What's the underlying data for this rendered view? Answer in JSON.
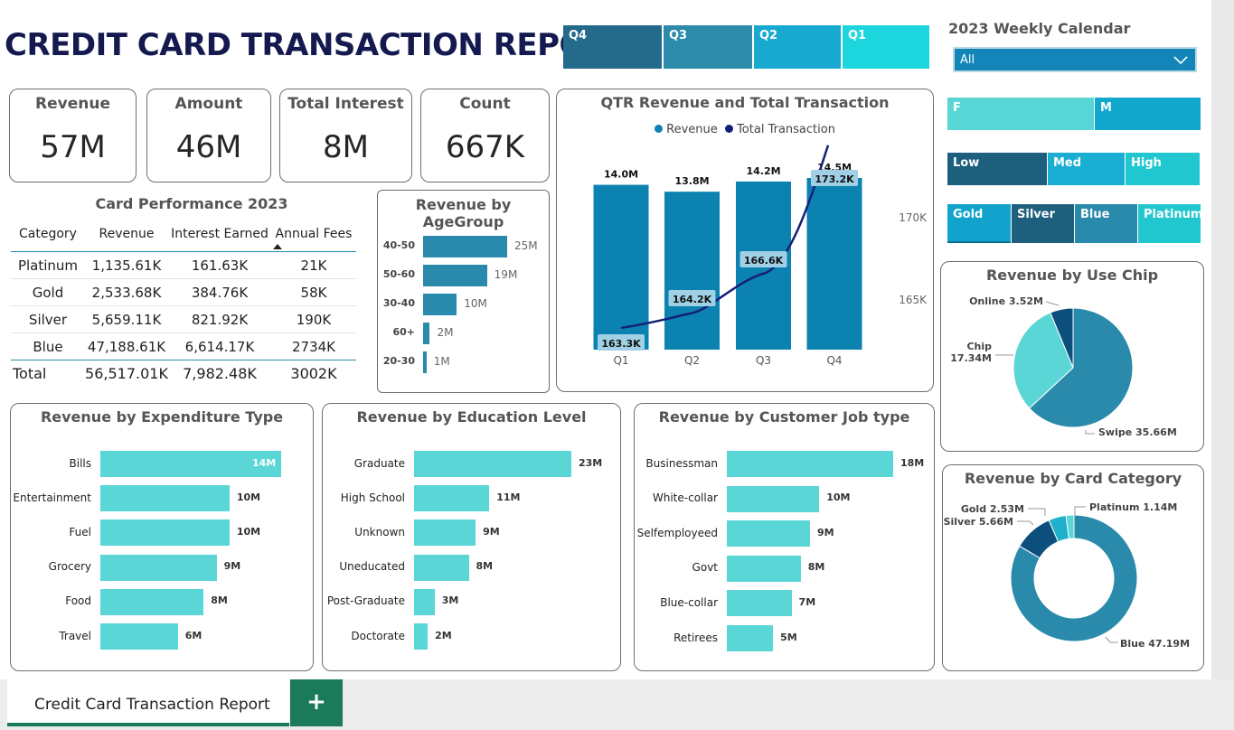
{
  "report_title": "CREDIT CARD TRANSACTION REPORT",
  "colors": {
    "teal_light": "#5ad6d6",
    "teal_mid": "#0c82b0",
    "navy": "#142078",
    "dark_slate": "#1f5f7e"
  },
  "quarter_slicer": {
    "items": [
      "Q4",
      "Q3",
      "Q2",
      "Q1"
    ]
  },
  "calendar": {
    "title": "2023 Weekly Calendar",
    "selected": "All"
  },
  "gender_slicer": {
    "items": [
      "F",
      "M"
    ]
  },
  "income_slicer": {
    "items": [
      "Low",
      "Med",
      "High"
    ]
  },
  "category_slicer": {
    "items": [
      "Gold",
      "Silver",
      "Blue",
      "Platinum"
    ]
  },
  "kpis": [
    {
      "label": "Revenue",
      "value": "57M"
    },
    {
      "label": "Amount",
      "value": "46M"
    },
    {
      "label": "Total Interest",
      "value": "8M"
    },
    {
      "label": "Count",
      "value": "667K"
    }
  ],
  "card_performance": {
    "title": "Card Performance 2023",
    "headers": [
      "Category",
      "Revenue",
      "Interest Earned",
      "Annual Fees"
    ],
    "rows": [
      [
        "Platinum",
        "1,135.61K",
        "161.63K",
        "21K"
      ],
      [
        "Gold",
        "2,533.68K",
        "384.76K",
        "58K"
      ],
      [
        "Silver",
        "5,659.11K",
        "821.92K",
        "190K"
      ],
      [
        "Blue",
        "47,188.61K",
        "6,614.17K",
        "2734K"
      ]
    ],
    "total": [
      "Total",
      "56,517.01K",
      "7,982.48K",
      "3002K"
    ]
  },
  "chart_data": [
    {
      "id": "age",
      "type": "bar",
      "title": "Revenue by AgeGroup",
      "categories": [
        "40-50",
        "50-60",
        "30-40",
        "60+",
        "20-30"
      ],
      "values": [
        25,
        19,
        10,
        2,
        1
      ],
      "labels": [
        "25M",
        "19M",
        "10M",
        "2M",
        "1M"
      ],
      "color": "#2a8aab"
    },
    {
      "id": "qtr",
      "type": "bar",
      "title": "QTR Revenue and Total Transaction",
      "legend": [
        "Revenue",
        "Total Transaction"
      ],
      "categories": [
        "Q1",
        "Q2",
        "Q3",
        "Q4"
      ],
      "series": [
        {
          "name": "Revenue",
          "values": [
            14.0,
            13.8,
            14.2,
            14.5
          ],
          "labels": [
            "14.0M",
            "13.8M",
            "14.2M",
            "14.5M"
          ]
        },
        {
          "name": "Total Transaction",
          "values": [
            163.3,
            164.2,
            166.6,
            173.2
          ],
          "labels": [
            "163.3K",
            "164.2K",
            "166.6K",
            "173.2K"
          ]
        }
      ],
      "y2_ticks": [
        "170K",
        "165K"
      ]
    },
    {
      "id": "exp",
      "type": "bar",
      "title": "Revenue by Expenditure Type",
      "categories": [
        "Bills",
        "Entertainment",
        "Fuel",
        "Grocery",
        "Food",
        "Travel"
      ],
      "values": [
        14,
        10,
        10,
        9,
        8,
        6
      ],
      "labels": [
        "14M",
        "10M",
        "10M",
        "9M",
        "8M",
        "6M"
      ],
      "color": "#5ad6d6"
    },
    {
      "id": "edu",
      "type": "bar",
      "title": "Revenue by Education Level",
      "categories": [
        "Graduate",
        "High School",
        "Unknown",
        "Uneducated",
        "Post-Graduate",
        "Doctorate"
      ],
      "values": [
        23,
        11,
        9,
        8,
        3,
        2
      ],
      "labels": [
        "23M",
        "11M",
        "9M",
        "8M",
        "3M",
        "2M"
      ],
      "color": "#5ad6d6"
    },
    {
      "id": "job",
      "type": "bar",
      "title": "Revenue by Customer Job type",
      "categories": [
        "Businessman",
        "White-collar",
        "Selfemployeed",
        "Govt",
        "Blue-collar",
        "Retirees"
      ],
      "values": [
        18,
        10,
        9,
        8,
        7,
        5
      ],
      "labels": [
        "18M",
        "10M",
        "9M",
        "8M",
        "7M",
        "5M"
      ],
      "color": "#5ad6d6"
    },
    {
      "id": "chip",
      "type": "pie",
      "title": "Revenue by Use Chip",
      "categories": [
        "Swipe",
        "Chip",
        "Online"
      ],
      "values": [
        35.66,
        17.34,
        3.52
      ],
      "labels": [
        "Swipe 35.66M",
        "Chip 17.34M",
        "Online 3.52M"
      ],
      "colors": [
        "#2a8aab",
        "#5ad6d6",
        "#0d4f7c"
      ]
    },
    {
      "id": "cat",
      "type": "pie",
      "title": "Revenue by Card Category",
      "categories": [
        "Blue",
        "Silver",
        "Gold",
        "Platinum"
      ],
      "values": [
        47.19,
        5.66,
        2.53,
        1.14
      ],
      "labels": [
        "Blue 47.19M",
        "Silver 5.66M",
        "Gold 2.53M",
        "Platinum 1.14M"
      ],
      "colors": [
        "#2a8aab",
        "#0d4f7c",
        "#1fb0cc",
        "#5ad6d6"
      ]
    }
  ],
  "tabs": {
    "active": "Credit Card Transaction Report",
    "add": "+"
  }
}
